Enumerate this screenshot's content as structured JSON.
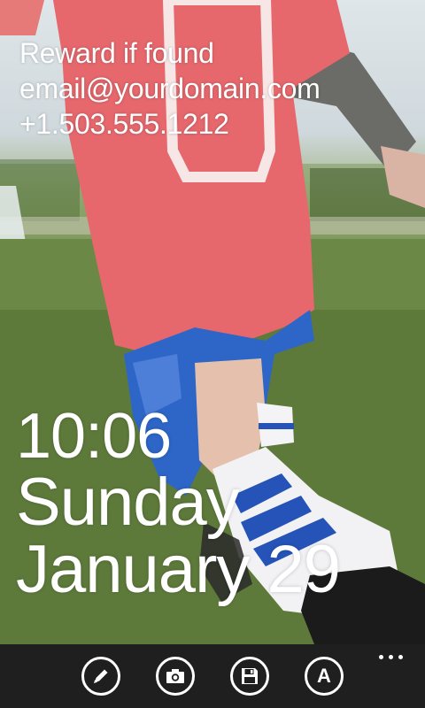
{
  "lock_screen": {
    "contact_lines": [
      "Reward if found",
      "email@yourdomain.com",
      "+1.503.555.1212"
    ],
    "time": "10:06",
    "day": "Sunday",
    "date": "January 29"
  },
  "app_bar": {
    "buttons": [
      {
        "name": "edit",
        "icon": "pencil-icon"
      },
      {
        "name": "camera",
        "icon": "camera-icon"
      },
      {
        "name": "save",
        "icon": "floppy-disk-icon"
      },
      {
        "name": "font",
        "icon": "font-a-icon",
        "glyph": "A"
      }
    ],
    "more_icon": "ellipsis-icon"
  },
  "colors": {
    "app_bar_background": "#1f1f1f",
    "text": "#ffffff"
  }
}
